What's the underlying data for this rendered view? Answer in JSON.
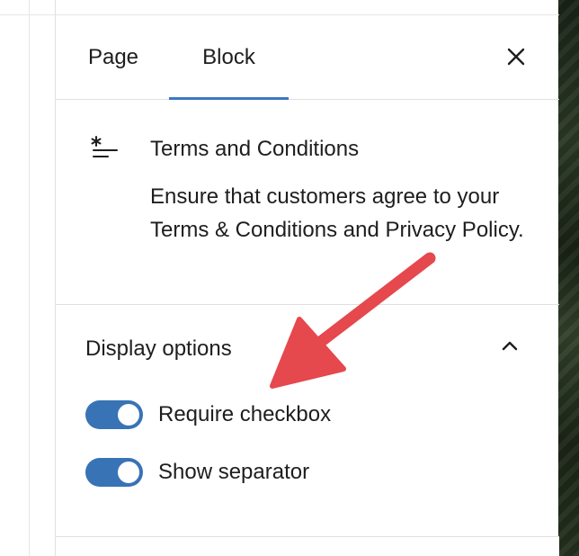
{
  "tabs": [
    {
      "label": "Page"
    },
    {
      "label": "Block"
    }
  ],
  "close_icon": "close-icon",
  "block_card": {
    "icon": "terms-icon",
    "title": "Terms and Conditions",
    "description": "Ensure that customers agree to your Terms & Conditions and Privacy Policy."
  },
  "display_options": {
    "title": "Display options",
    "chevron_icon": "chevron-up-icon",
    "options": [
      {
        "label": "Require checkbox",
        "enabled": true
      },
      {
        "label": "Show separator",
        "enabled": true
      }
    ]
  },
  "colors": {
    "accent": "#3873b6",
    "tab_indicator": "#3c78c2",
    "annotation_arrow": "#e5484d"
  }
}
